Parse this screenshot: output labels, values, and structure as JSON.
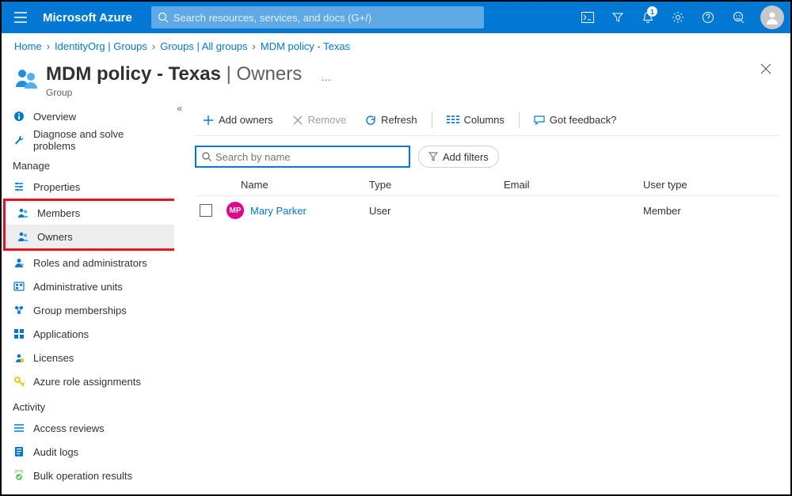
{
  "topbar": {
    "brand": "Microsoft Azure",
    "search_placeholder": "Search resources, services, and docs (G+/)",
    "notification_count": "1"
  },
  "breadcrumb": [
    "Home",
    "IdentityOrg | Groups",
    "Groups | All groups",
    "MDM policy - Texas"
  ],
  "page": {
    "title_bold": "MDM policy - Texas",
    "title_rest": " | Owners",
    "subtitle": "Group",
    "more": "…"
  },
  "sidebar": {
    "items_top": [
      {
        "label": "Overview",
        "icon": "info"
      },
      {
        "label": "Diagnose and solve problems",
        "icon": "wrench"
      }
    ],
    "section_manage": "Manage",
    "items_manage": [
      {
        "label": "Properties",
        "icon": "sliders"
      },
      {
        "label": "Members",
        "icon": "people",
        "hl_top": true
      },
      {
        "label": "Owners",
        "icon": "people",
        "selected": true,
        "hl_bottom": true
      },
      {
        "label": "Roles and administrators",
        "icon": "admin"
      },
      {
        "label": "Administrative units",
        "icon": "units"
      },
      {
        "label": "Group memberships",
        "icon": "memberships"
      },
      {
        "label": "Applications",
        "icon": "apps"
      },
      {
        "label": "Licenses",
        "icon": "license"
      },
      {
        "label": "Azure role assignments",
        "icon": "key"
      }
    ],
    "section_activity": "Activity",
    "items_activity": [
      {
        "label": "Access reviews",
        "icon": "reviews"
      },
      {
        "label": "Audit logs",
        "icon": "logs"
      },
      {
        "label": "Bulk operation results",
        "icon": "bulk"
      }
    ]
  },
  "commands": {
    "add_owners": "Add owners",
    "remove": "Remove",
    "refresh": "Refresh",
    "columns": "Columns",
    "feedback": "Got feedback?"
  },
  "filters": {
    "search_placeholder": "Search by name",
    "add_filters": "Add filters"
  },
  "table": {
    "headers": {
      "name": "Name",
      "type": "Type",
      "email": "Email",
      "usertype": "User type"
    },
    "rows": [
      {
        "initials": "MP",
        "name": "Mary Parker",
        "type": "User",
        "email": "",
        "usertype": "Member"
      }
    ]
  }
}
